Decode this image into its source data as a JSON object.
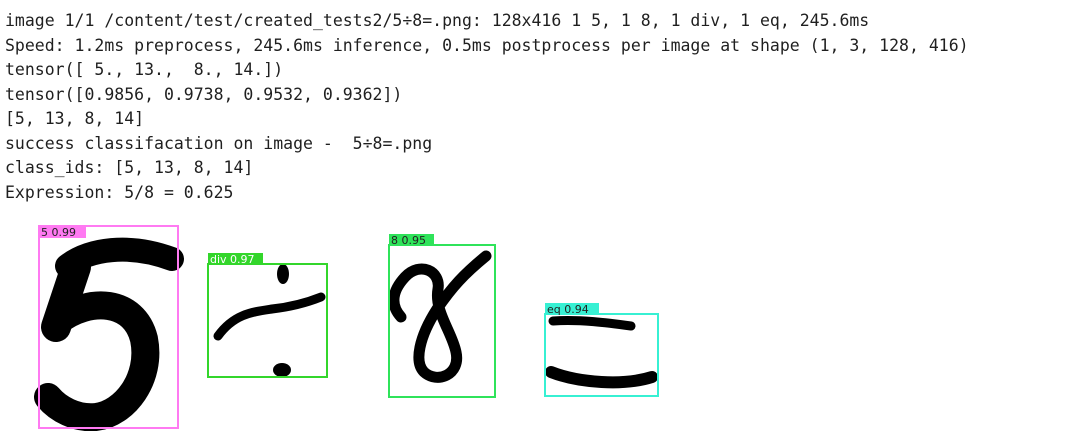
{
  "output_lines": [
    "image 1/1 /content/test/created_tests2/5÷8=.png: 128x416 1 5, 1 8, 1 div, 1 eq, 245.6ms",
    "Speed: 1.2ms preprocess, 245.6ms inference, 0.5ms postprocess per image at shape (1, 3, 128, 416)",
    "tensor([ 5., 13.,  8., 14.])",
    "tensor([0.9856, 0.9738, 0.9532, 0.9362])",
    "[5, 13, 8, 14]",
    "success classifacation on image -  5÷8=.png",
    "class_ids: [5, 13, 8, 14]",
    "Expression: 5/8 = 0.625"
  ],
  "detections": [
    {
      "label": "5 0.99",
      "class": "5",
      "confidence": 0.99,
      "color": "#ff7af2",
      "label_text_color": "#222222"
    },
    {
      "label": "div 0.97",
      "class": "div",
      "confidence": 0.97,
      "color": "#33d62b",
      "label_text_color": "#ffffff"
    },
    {
      "label": "8 0.95",
      "class": "8",
      "confidence": 0.95,
      "color": "#2fe35a",
      "label_text_color": "#222222"
    },
    {
      "label": "eq 0.94",
      "class": "eq",
      "confidence": 0.94,
      "color": "#37f0d3",
      "label_text_color": "#222222"
    }
  ]
}
